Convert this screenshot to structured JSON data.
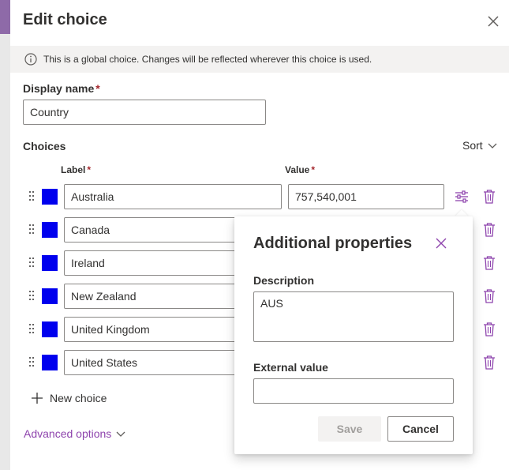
{
  "panel": {
    "title": "Edit choice",
    "banner_text": "This is a global choice. Changes will be reflected wherever this choice is used."
  },
  "display_name": {
    "label": "Display name",
    "required_mark": "*",
    "value": "Country"
  },
  "choices": {
    "section_label": "Choices",
    "sort_label": "Sort",
    "label_header": "Label",
    "value_header": "Value",
    "required_mark": "*",
    "items": [
      {
        "label": "Australia",
        "value": "757,540,001",
        "color": "#0000ee"
      },
      {
        "label": "Canada",
        "color": "#0000ee"
      },
      {
        "label": "Ireland",
        "color": "#0000ee"
      },
      {
        "label": "New Zealand",
        "color": "#0000ee"
      },
      {
        "label": "United Kingdom",
        "color": "#0000ee"
      },
      {
        "label": "United States",
        "color": "#0000ee"
      }
    ],
    "new_choice_label": "New choice"
  },
  "advanced_options_label": "Advanced options",
  "popup": {
    "title": "Additional properties",
    "description_label": "Description",
    "description_value": "AUS",
    "external_value_label": "External value",
    "external_value": "",
    "save_label": "Save",
    "cancel_label": "Cancel"
  },
  "colors": {
    "accent": "#8e44ad",
    "swatch": "#0000ee",
    "required": "#a4262c"
  }
}
